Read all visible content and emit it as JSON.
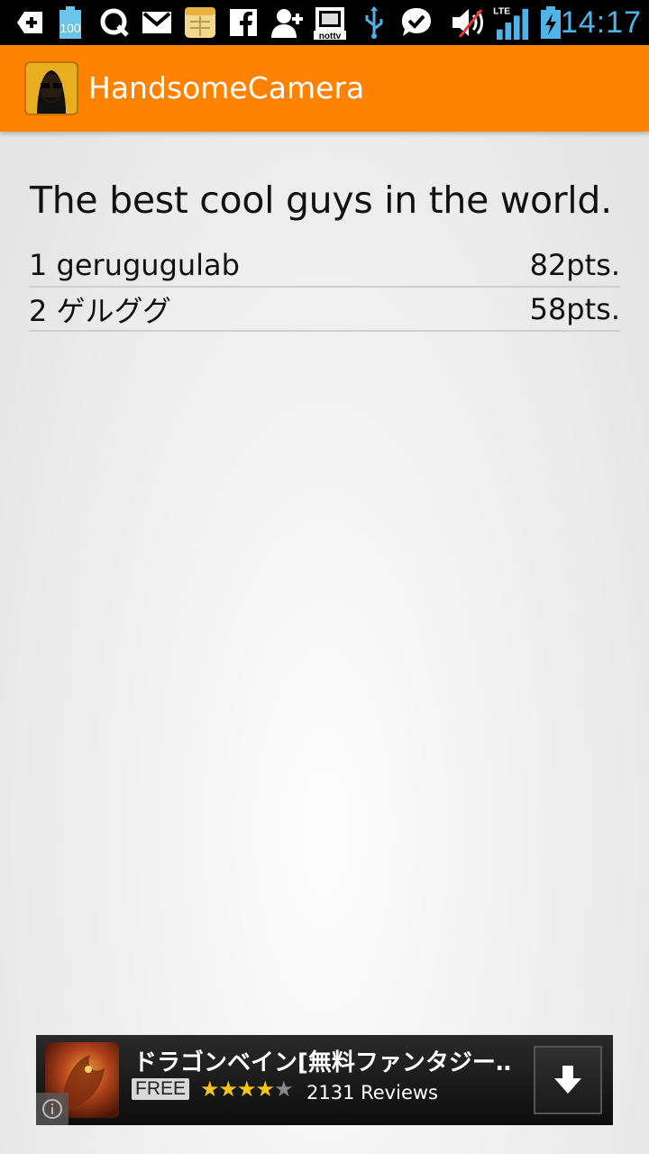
{
  "status_bar": {
    "battery_percent_icon_text": "100",
    "tv_icon_text": "nottv",
    "network": "LTE",
    "time": "14:17",
    "icons": [
      "add-icon",
      "battery-100-icon",
      "q-icon",
      "gmail-icon",
      "notes-icon",
      "facebook-icon",
      "add-contact-icon",
      "nottv-icon",
      "usb-icon",
      "check-bubble-icon",
      "mute-icon",
      "signal-icon",
      "battery-charging-icon"
    ],
    "clock_color": "#4fb3e8"
  },
  "app_bar": {
    "title": "HandsomeCamera",
    "color": "#ff8200"
  },
  "main": {
    "heading": "The best cool guys in the world.",
    "ranking": [
      {
        "rank": "1",
        "name": "gerugugulab",
        "points": "82pts."
      },
      {
        "rank": "2",
        "name": "ゲルググ",
        "points": "58pts."
      }
    ]
  },
  "ad": {
    "title": "ドラゴンベイン[無料ファンタジー…",
    "price_badge": "FREE",
    "rating": 4,
    "rating_max": 5,
    "reviews": "2131 Reviews"
  }
}
